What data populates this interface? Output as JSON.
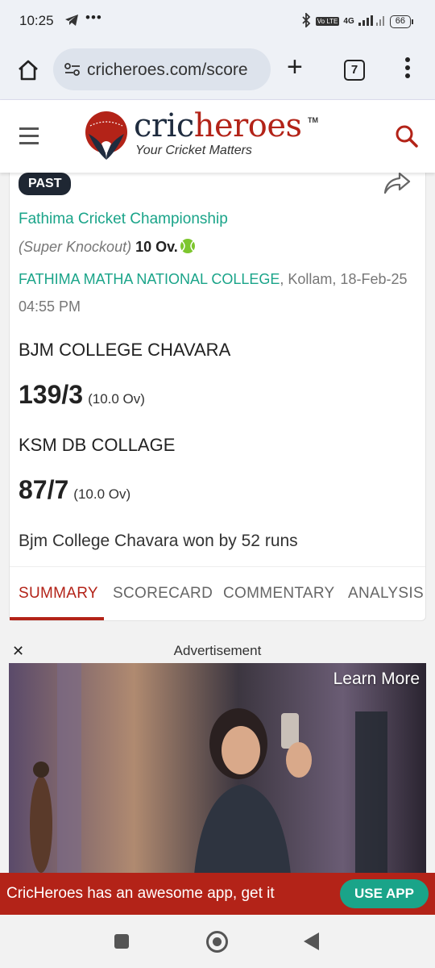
{
  "status_bar": {
    "time": "10:25",
    "dots": "•••",
    "network": "4G",
    "battery": "66"
  },
  "browser": {
    "url": "cricheroes.com/score",
    "tab_count": "7",
    "new_tab_glyph": "+"
  },
  "site": {
    "logo_part1": "cric",
    "logo_part2": "heroes",
    "logo_tm": "TM",
    "tagline": "Your Cricket Matters",
    "brand_red": "#b32318",
    "brand_navy": "#1f2c3f",
    "accent_green": "#1aa489"
  },
  "match": {
    "status": "PAST",
    "tournament": "Fathima Cricket Championship",
    "round": "(Super Knockout)",
    "overs": "10 Ov.",
    "venue": "FATHIMA MATHA NATIONAL COLLEGE",
    "location_date": ", Kollam, 18-Feb-25 04:55 PM",
    "teams": [
      {
        "name": "BJM COLLEGE CHAVARA",
        "score": "139/3",
        "overs": "(10.0 Ov)"
      },
      {
        "name": "KSM DB COLLAGE",
        "score": "87/7",
        "overs": "(10.0 Ov)"
      }
    ],
    "result": "Bjm College Chavara won by 52 runs"
  },
  "tabs": [
    {
      "label": "SUMMARY",
      "active": true
    },
    {
      "label": "SCORECARD",
      "active": false
    },
    {
      "label": "COMMENTARY",
      "active": false
    },
    {
      "label": "ANALYSIS",
      "active": false
    }
  ],
  "ad": {
    "close": "✕",
    "label": "Advertisement",
    "cta": "Learn More"
  },
  "app_banner": {
    "text": "CricHeroes has an awesome app, get it",
    "button": "USE APP"
  }
}
